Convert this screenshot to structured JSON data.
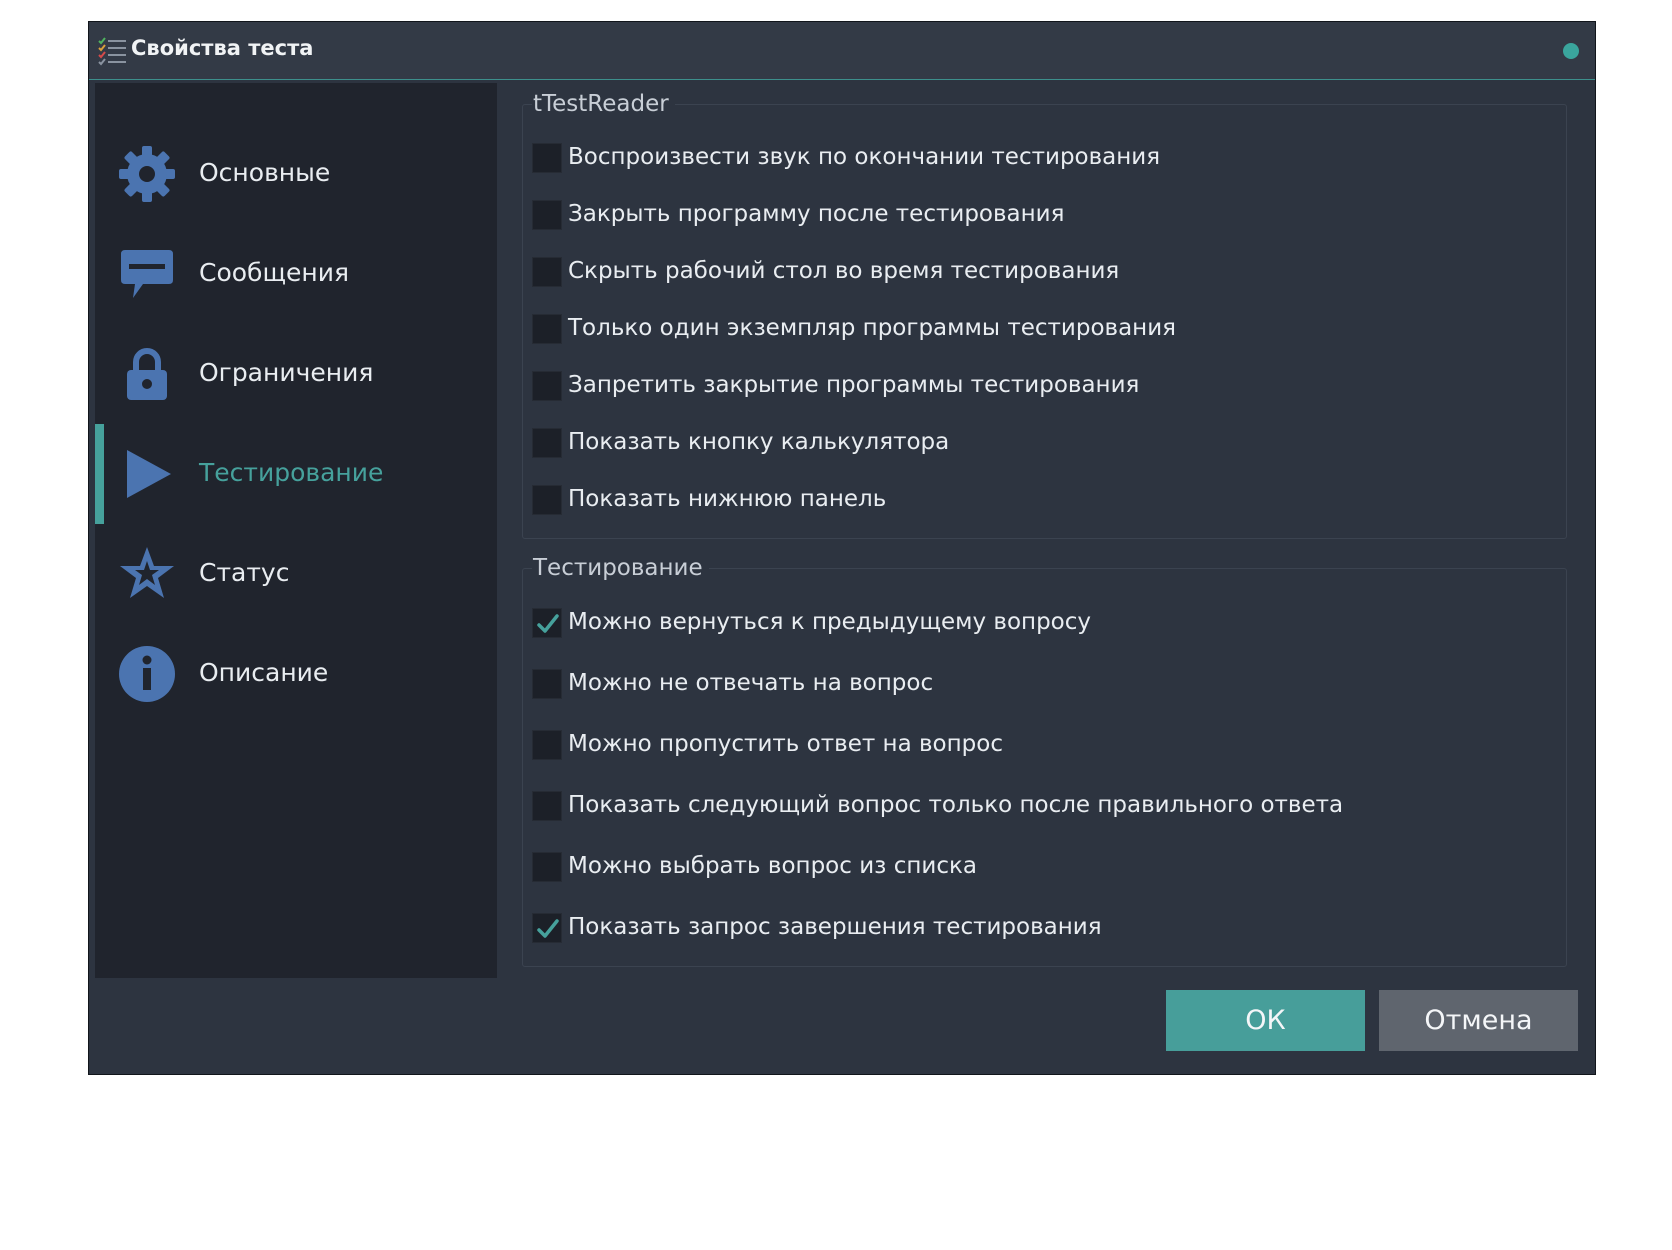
{
  "window": {
    "title": "Свойства теста"
  },
  "colors": {
    "accent": "#46a19c",
    "icon_blue": "#4b74b0",
    "sidebar_bg": "#20242d",
    "content_bg": "#2d3440",
    "status_dot": "#3aa59d"
  },
  "sidebar": {
    "active_index": 3,
    "items": [
      {
        "label": "Основные",
        "icon": "gear-icon"
      },
      {
        "label": "Сообщения",
        "icon": "message-icon"
      },
      {
        "label": "Ограничения",
        "icon": "lock-icon"
      },
      {
        "label": "Тестирование",
        "icon": "play-icon"
      },
      {
        "label": "Статус",
        "icon": "star-icon"
      },
      {
        "label": "Описание",
        "icon": "info-icon"
      }
    ]
  },
  "groups": {
    "reader": {
      "title": "tTestReader",
      "options": [
        {
          "label": "Воспроизвести звук по окончании тестирования",
          "checked": false
        },
        {
          "label": "Закрыть программу после тестирования",
          "checked": false
        },
        {
          "label": "Скрыть рабочий стол во время тестирования",
          "checked": false
        },
        {
          "label": "Только один экземпляр программы тестирования",
          "checked": false
        },
        {
          "label": "Запретить закрытие программы тестирования",
          "checked": false
        },
        {
          "label": "Показать кнопку калькулятора",
          "checked": false
        },
        {
          "label": "Показать нижнюю панель",
          "checked": false
        }
      ]
    },
    "testing": {
      "title": "Тестирование",
      "options": [
        {
          "label": "Можно вернуться к предыдущему вопросу",
          "checked": true
        },
        {
          "label": "Можно не отвечать на вопрос",
          "checked": false
        },
        {
          "label": "Можно пропустить ответ на вопрос",
          "checked": false
        },
        {
          "label": "Показать следующий вопрос только после правильного ответа",
          "checked": false
        },
        {
          "label": "Можно выбрать вопрос из списка",
          "checked": false
        },
        {
          "label": "Показать запрос завершения тестирования",
          "checked": true
        }
      ]
    }
  },
  "buttons": {
    "ok_label": "ОК",
    "cancel_label": "Отмена"
  }
}
